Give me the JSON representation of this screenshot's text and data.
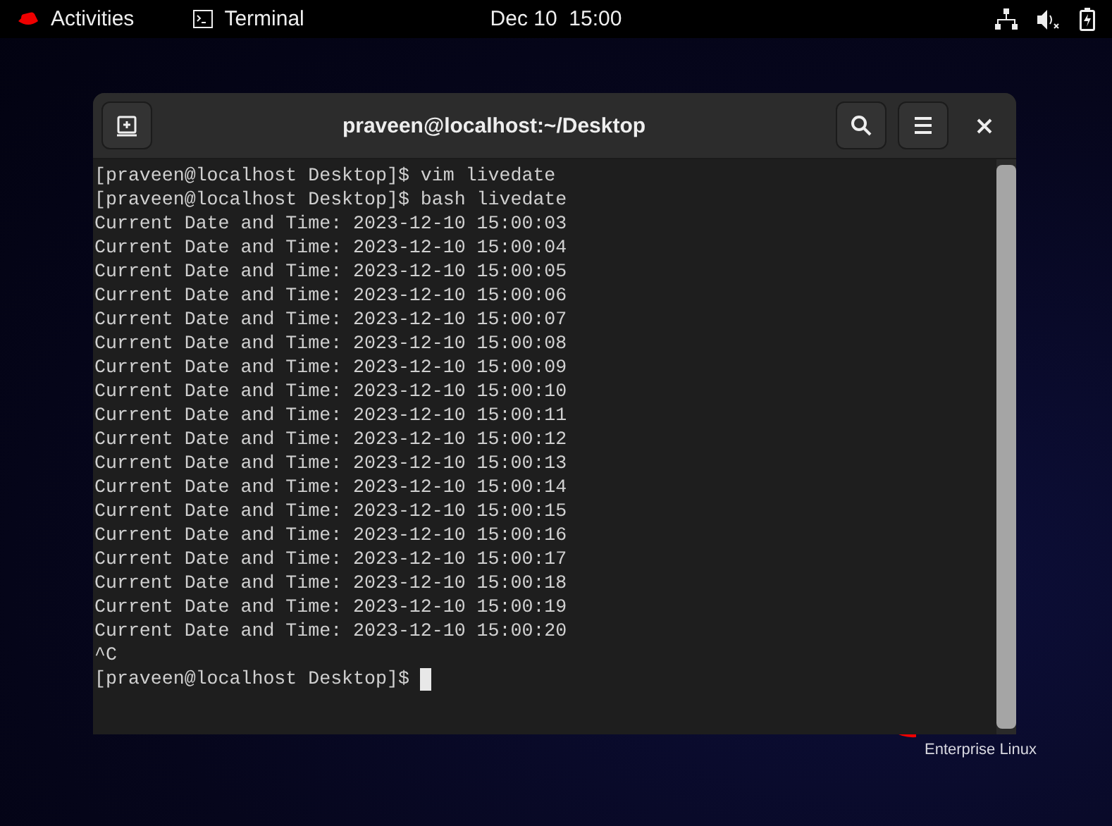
{
  "top_bar": {
    "activities": "Activities",
    "app_name": "Terminal",
    "clock": "Dec 10  15:00"
  },
  "window": {
    "title": "praveen@localhost:~/Desktop",
    "lines": [
      "[praveen@localhost Desktop]$ vim livedate",
      "[praveen@localhost Desktop]$ bash livedate",
      "Current Date and Time: 2023-12-10 15:00:03",
      "Current Date and Time: 2023-12-10 15:00:04",
      "Current Date and Time: 2023-12-10 15:00:05",
      "Current Date and Time: 2023-12-10 15:00:06",
      "Current Date and Time: 2023-12-10 15:00:07",
      "Current Date and Time: 2023-12-10 15:00:08",
      "Current Date and Time: 2023-12-10 15:00:09",
      "Current Date and Time: 2023-12-10 15:00:10",
      "Current Date and Time: 2023-12-10 15:00:11",
      "Current Date and Time: 2023-12-10 15:00:12",
      "Current Date and Time: 2023-12-10 15:00:13",
      "Current Date and Time: 2023-12-10 15:00:14",
      "Current Date and Time: 2023-12-10 15:00:15",
      "Current Date and Time: 2023-12-10 15:00:16",
      "Current Date and Time: 2023-12-10 15:00:17",
      "Current Date and Time: 2023-12-10 15:00:18",
      "Current Date and Time: 2023-12-10 15:00:19",
      "Current Date and Time: 2023-12-10 15:00:20",
      "^C"
    ],
    "prompt": "[praveen@localhost Desktop]$ "
  },
  "desktop": {
    "brand_subtitle": "Enterprise Linux"
  }
}
